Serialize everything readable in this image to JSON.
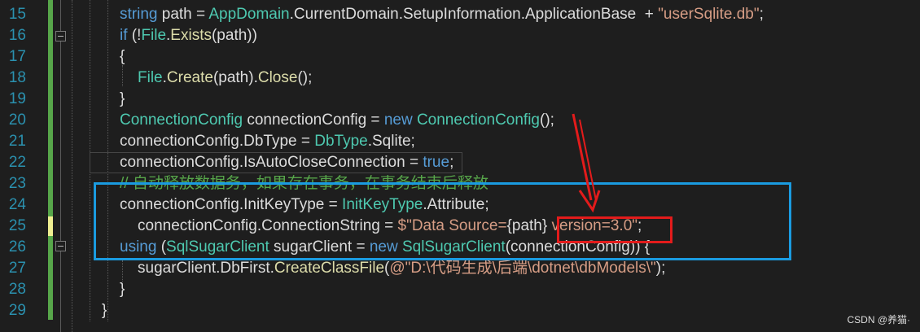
{
  "editor": {
    "line_numbers": [
      "15",
      "16",
      "17",
      "18",
      "19",
      "20",
      "21",
      "22",
      "23",
      "24",
      "25",
      "26",
      "27",
      "28",
      "29"
    ],
    "lines": [
      [
        {
          "t": "string",
          "c": "kw"
        },
        {
          "t": " path = ",
          "c": "id"
        },
        {
          "t": "AppDomain",
          "c": "ty"
        },
        {
          "t": ".CurrentDomain.SetupInformation.ApplicationBase  + ",
          "c": "id"
        },
        {
          "t": "\"userSqlite.db\"",
          "c": "str"
        },
        {
          "t": ";",
          "c": "id"
        }
      ],
      [
        {
          "t": "if",
          "c": "kw"
        },
        {
          "t": " (!",
          "c": "id"
        },
        {
          "t": "File",
          "c": "ty"
        },
        {
          "t": ".",
          "c": "id"
        },
        {
          "t": "Exists",
          "c": "fn"
        },
        {
          "t": "(path))",
          "c": "id"
        }
      ],
      [
        {
          "t": "{",
          "c": "id"
        }
      ],
      [
        {
          "t": "File",
          "c": "ty"
        },
        {
          "t": ".",
          "c": "id"
        },
        {
          "t": "Create",
          "c": "fn"
        },
        {
          "t": "(path).",
          "c": "id"
        },
        {
          "t": "Close",
          "c": "fn"
        },
        {
          "t": "();",
          "c": "id"
        }
      ],
      [
        {
          "t": "}",
          "c": "id"
        }
      ],
      [
        {
          "t": "ConnectionConfig",
          "c": "ty"
        },
        {
          "t": " connectionConfig = ",
          "c": "id"
        },
        {
          "t": "new",
          "c": "kw"
        },
        {
          "t": " ",
          "c": "id"
        },
        {
          "t": "ConnectionConfig",
          "c": "ty"
        },
        {
          "t": "();",
          "c": "id"
        }
      ],
      [
        {
          "t": "connectionConfig.DbType = ",
          "c": "id"
        },
        {
          "t": "DbType",
          "c": "ty"
        },
        {
          "t": ".Sqlite;",
          "c": "id"
        }
      ],
      [
        {
          "t": "connectionConfig.IsAutoCloseConnection = ",
          "c": "id"
        },
        {
          "t": "true",
          "c": "kw"
        },
        {
          "t": ";",
          "c": "id"
        }
      ],
      [
        {
          "t": "// 自动释放数据务，如果存在事务，在事务结束后释放",
          "c": "cm"
        }
      ],
      [
        {
          "t": "connectionConfig.InitKeyType = ",
          "c": "id"
        },
        {
          "t": "InitKeyType",
          "c": "ty"
        },
        {
          "t": ".Attribute;",
          "c": "id"
        }
      ],
      [
        {
          "t": "connectionConfig.ConnectionString = ",
          "c": "id"
        },
        {
          "t": "$\"Data Source=",
          "c": "str"
        },
        {
          "t": "{path}",
          "c": "interp"
        },
        {
          "t": " version=3.0\"",
          "c": "str"
        },
        {
          "t": ";",
          "c": "id"
        }
      ],
      [
        {
          "t": "using",
          "c": "kw"
        },
        {
          "t": " (",
          "c": "id"
        },
        {
          "t": "SqlSugarClient",
          "c": "ty"
        },
        {
          "t": " sugarClient = ",
          "c": "id"
        },
        {
          "t": "new",
          "c": "kw"
        },
        {
          "t": " ",
          "c": "id"
        },
        {
          "t": "SqlSugarClient",
          "c": "ty"
        },
        {
          "t": "(connectionConfig)) {",
          "c": "id"
        }
      ],
      [
        {
          "t": "sugarClient.DbFirst.",
          "c": "id"
        },
        {
          "t": "CreateClassFile",
          "c": "fn"
        },
        {
          "t": "(",
          "c": "id"
        },
        {
          "t": "@\"D:\\代码生成\\后端\\dotnet\\dbModels\\\"",
          "c": "str"
        },
        {
          "t": ");",
          "c": "id"
        }
      ],
      [
        {
          "t": "}",
          "c": "id"
        }
      ],
      [
        {
          "t": "}",
          "c": "id"
        }
      ]
    ]
  },
  "watermark": "CSDN @养猫·"
}
